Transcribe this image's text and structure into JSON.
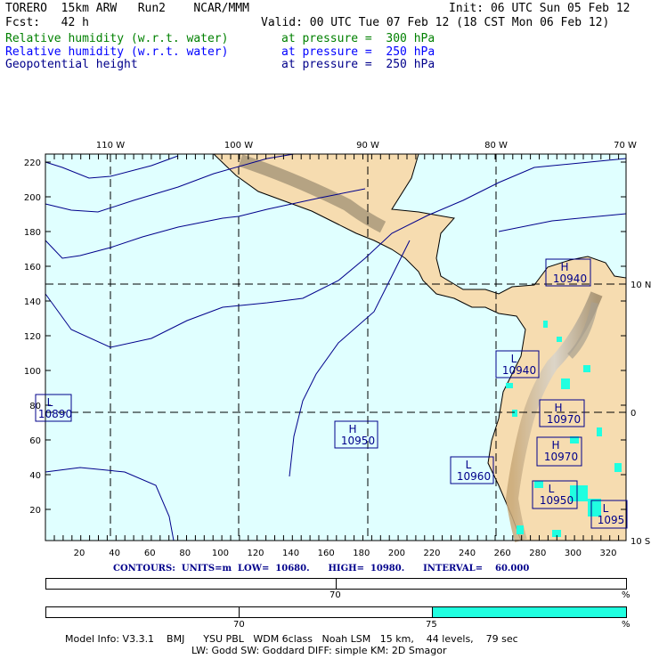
{
  "header": {
    "title": "TORERO  15km ARW   Run2    NCAR/MMM",
    "init": "Init: 06 UTC Sun 05 Feb 12",
    "fcst": "Fcst:   42 h",
    "valid": "Valid: 00 UTC Tue 07 Feb 12 (18 CST Mon 06 Feb 12)"
  },
  "fields": [
    {
      "name": "Relative humidity (w.r.t. water)",
      "level": "at pressure =  300 hPa",
      "color": "#008000"
    },
    {
      "name": "Relative humidity (w.r.t. water)",
      "level": "at pressure =  250 hPa",
      "color": "#0000ff"
    },
    {
      "name": "Geopotential height",
      "level": "at pressure =  250 hPa",
      "color": "#00008b"
    }
  ],
  "map": {
    "lon_labels": [
      "110 W",
      "100 W",
      "90 W",
      "80 W",
      "70 W"
    ],
    "lat_labels": [
      "10 N",
      "0",
      "10 S"
    ],
    "y_ticks": [
      "220",
      "200",
      "180",
      "160",
      "140",
      "120",
      "100",
      "80",
      "60",
      "40",
      "20"
    ],
    "x_ticks": [
      "20",
      "40",
      "60",
      "80",
      "100",
      "120",
      "140",
      "160",
      "180",
      "200",
      "220",
      "240",
      "260",
      "280",
      "300",
      "320"
    ],
    "centers": [
      {
        "type": "H",
        "value": "10940"
      },
      {
        "type": "L",
        "value": "10940"
      },
      {
        "type": "L",
        "value": "10890"
      },
      {
        "type": "H",
        "value": "10950"
      },
      {
        "type": "H",
        "value": "10970"
      },
      {
        "type": "H",
        "value": "10970"
      },
      {
        "type": "L",
        "value": "10960"
      },
      {
        "type": "L",
        "value": "10950"
      },
      {
        "type": "L",
        "value": "1095"
      }
    ]
  },
  "contours": {
    "text": "CONTOURS:  UNITS=m  LOW=  10680.      HIGH=  10980.      INTERVAL=    60.000"
  },
  "scale1": {
    "label": "70",
    "unit": "%"
  },
  "scale2": {
    "labels": [
      "70",
      "75"
    ],
    "unit": "%",
    "fill_color": "#20ffe0"
  },
  "footer": {
    "line1": "Model Info: V3.3.1    BMJ      YSU PBL   WDM 6class   Noah LSM   15 km,    44 levels,    79 sec",
    "line2": "LW: Godd SW: Goddard DIFF: simple KM: 2D Smagor"
  }
}
